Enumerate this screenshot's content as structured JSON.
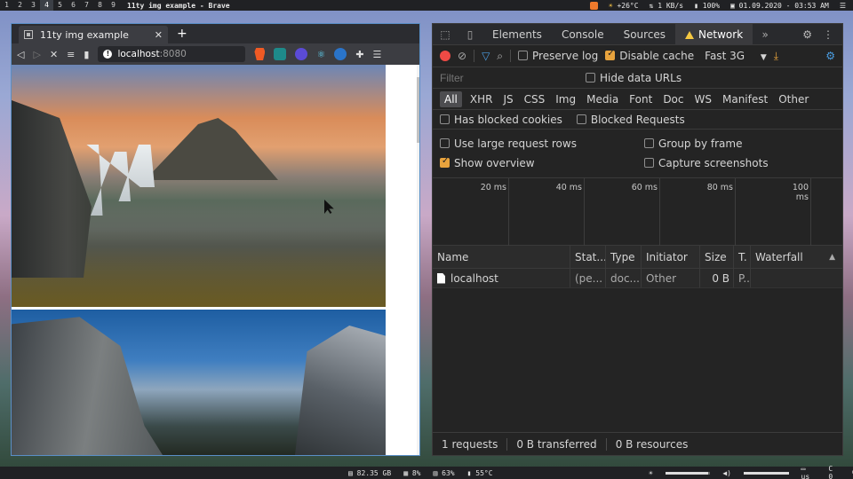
{
  "topbar": {
    "workspaces": [
      "1",
      "2",
      "3",
      "4",
      "5",
      "6",
      "7",
      "8",
      "9"
    ],
    "active_workspace": "4",
    "window_title": "11ty img example - Brave",
    "temperature": "+26°C",
    "network": "1 KB/s",
    "battery": "100%",
    "datetime": "01.09.2020 - 03:53 AM"
  },
  "bottombar": {
    "disk": "82.35 GB",
    "cpu": "8%",
    "memory": "63%",
    "temp": "55°C",
    "keyboard_layout": "us",
    "notifications": "0",
    "brightness_fraction": 0.95
  },
  "browser": {
    "tab_title": "11ty img example",
    "url_host": "localhost",
    "url_port": ":8080"
  },
  "devtools": {
    "tabs": [
      "Elements",
      "Console",
      "Sources",
      "Network"
    ],
    "active_tab": "Network",
    "preserve_log": "Preserve log",
    "disable_cache": "Disable cache",
    "throttle": "Fast 3G",
    "filter_placeholder": "Filter",
    "hide_data_urls": "Hide data URLs",
    "types": [
      "All",
      "XHR",
      "JS",
      "CSS",
      "Img",
      "Media",
      "Font",
      "Doc",
      "WS",
      "Manifest",
      "Other"
    ],
    "has_blocked_cookies": "Has blocked cookies",
    "blocked_requests": "Blocked Requests",
    "large_rows": "Use large request rows",
    "group_by_frame": "Group by frame",
    "show_overview": "Show overview",
    "capture_screenshots": "Capture screenshots",
    "timeline_ticks": [
      "20 ms",
      "40 ms",
      "60 ms",
      "80 ms",
      "100 ms"
    ],
    "columns": [
      "Name",
      "Stat...",
      "Type",
      "Initiator",
      "Size",
      "T.",
      "Waterfall"
    ],
    "rows": [
      {
        "name": "localhost",
        "status": "(pe...",
        "type": "doc...",
        "initiator": "Other",
        "size": "0 B",
        "time": "P..."
      }
    ],
    "status": {
      "requests": "1 requests",
      "transferred": "0 B transferred",
      "resources": "0 B resources"
    }
  }
}
